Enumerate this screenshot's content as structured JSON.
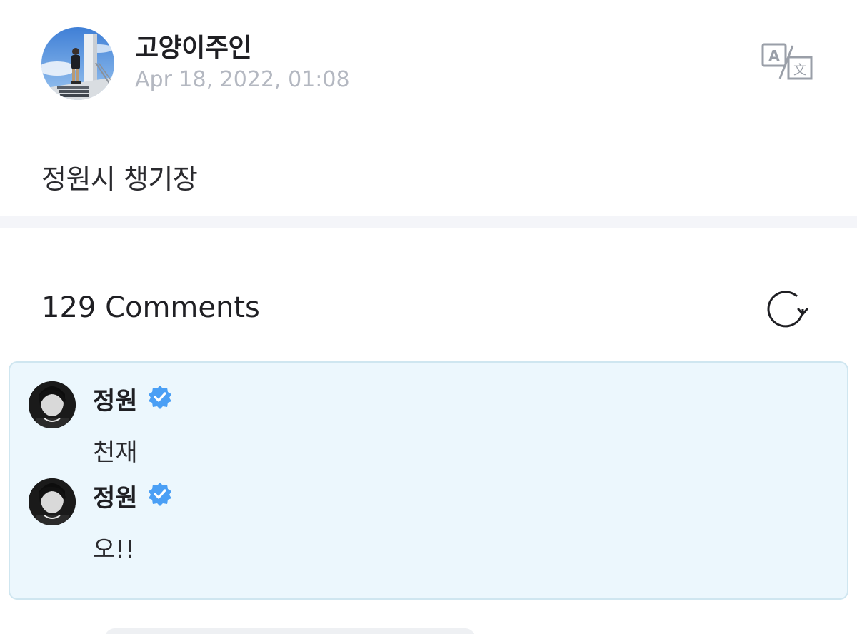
{
  "post": {
    "author": "고양이주인",
    "date": "Apr 18, 2022, 01:08",
    "body": "정원시 챙기장"
  },
  "comments_section": {
    "title": "129 Comments"
  },
  "comments": [
    {
      "author": "정원",
      "verified": true,
      "text": "천재"
    },
    {
      "author": "정원",
      "verified": true,
      "text": "오!!"
    }
  ],
  "icons": {
    "translate": "translate-icon",
    "refresh": "refresh-icon",
    "verified": "verified-badge-icon"
  },
  "colors": {
    "verified_badge": "#4a9ff5",
    "date_text": "#b4b8c1",
    "highlight_bg": "#ecf7fd",
    "highlight_border": "#cfe6f0"
  }
}
